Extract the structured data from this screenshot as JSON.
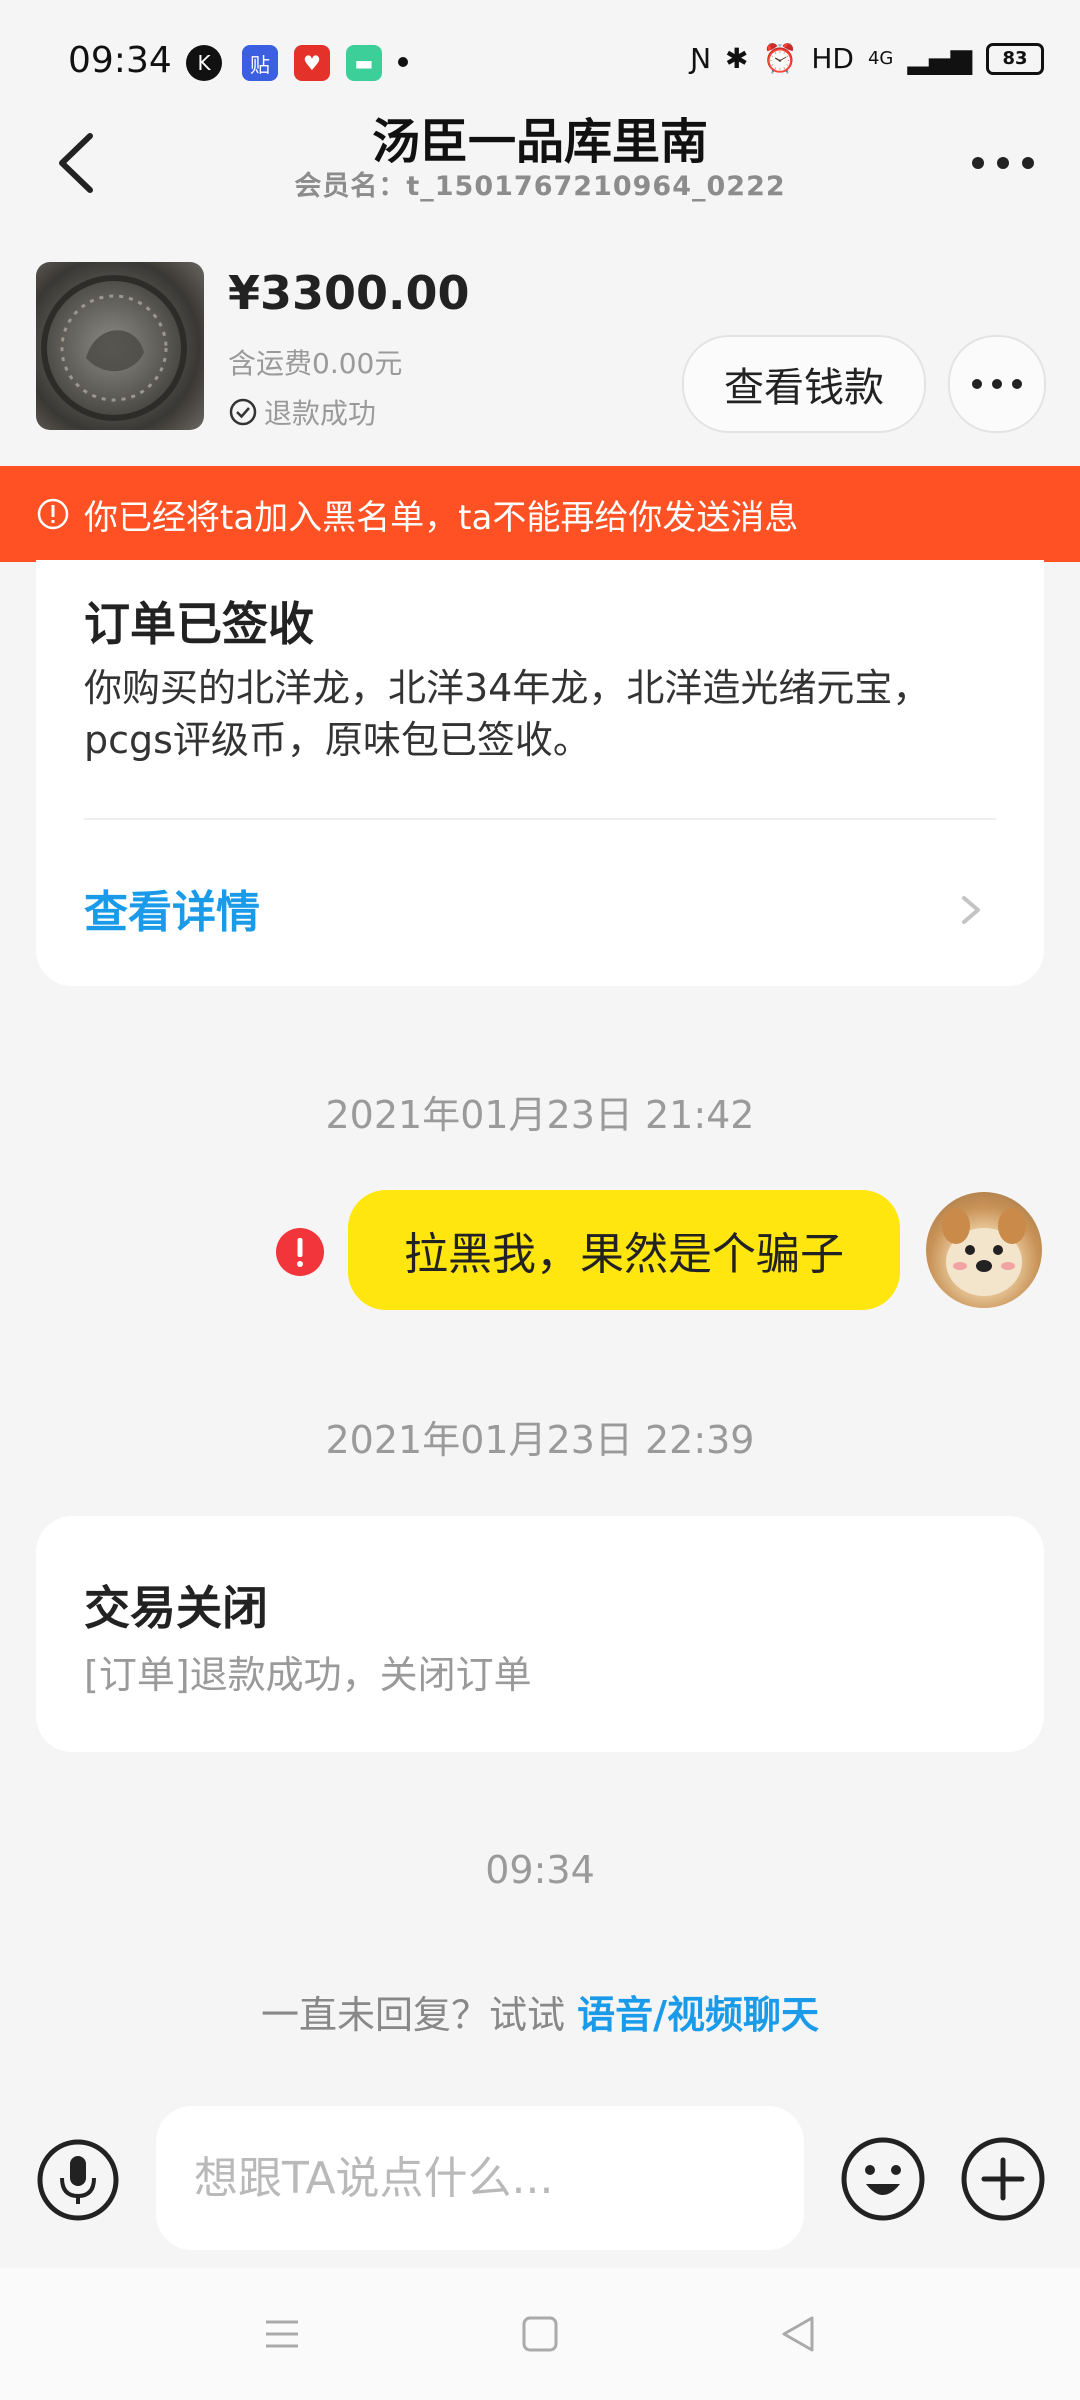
{
  "status_bar": {
    "time": "09:34",
    "app_icons": [
      "k-circle-icon",
      "tieba-icon",
      "pinduoduo-icon",
      "message-app-icon"
    ],
    "right_text": "HD",
    "network": "4G",
    "battery": "83",
    "colors": {
      "tieba": "#3b5fe0",
      "pinduoduo": "#e4322a",
      "message_app": "#3ccf9a"
    }
  },
  "header": {
    "title": "汤臣一品库里南",
    "subtitle": "会员名：t_1501767210964_0222"
  },
  "product": {
    "price": "¥3300.00",
    "shipping": "含运费0.00元",
    "status": "退款成功",
    "view_payment_label": "查看钱款"
  },
  "banner": {
    "text": "你已经将ta加入黑名单，ta不能再给你发送消息",
    "color": "#ff5123"
  },
  "order_card": {
    "title": "订单已签收",
    "description": "你购买的北洋龙，北洋34年龙，北洋造光绪元宝，pcgs评级币，原味包已签收。",
    "link_label": "查看详情"
  },
  "messages": {
    "timestamp_1": "2021年01月23日 21:42",
    "sent_text": "拉黑我，果然是个骗子",
    "timestamp_2": "2021年01月23日 22:39",
    "timestamp_3": "09:34"
  },
  "closed_card": {
    "title": "交易关闭",
    "description": "[订单]退款成功，关闭订单"
  },
  "hint": {
    "prefix": "一直未回复？试试 ",
    "link": "语音/视频聊天"
  },
  "input": {
    "placeholder": "想跟TA说点什么..."
  },
  "colors": {
    "accent_blue": "#1a9bea",
    "bubble_yellow": "#ffe60f",
    "error_red": "#f2353a"
  }
}
